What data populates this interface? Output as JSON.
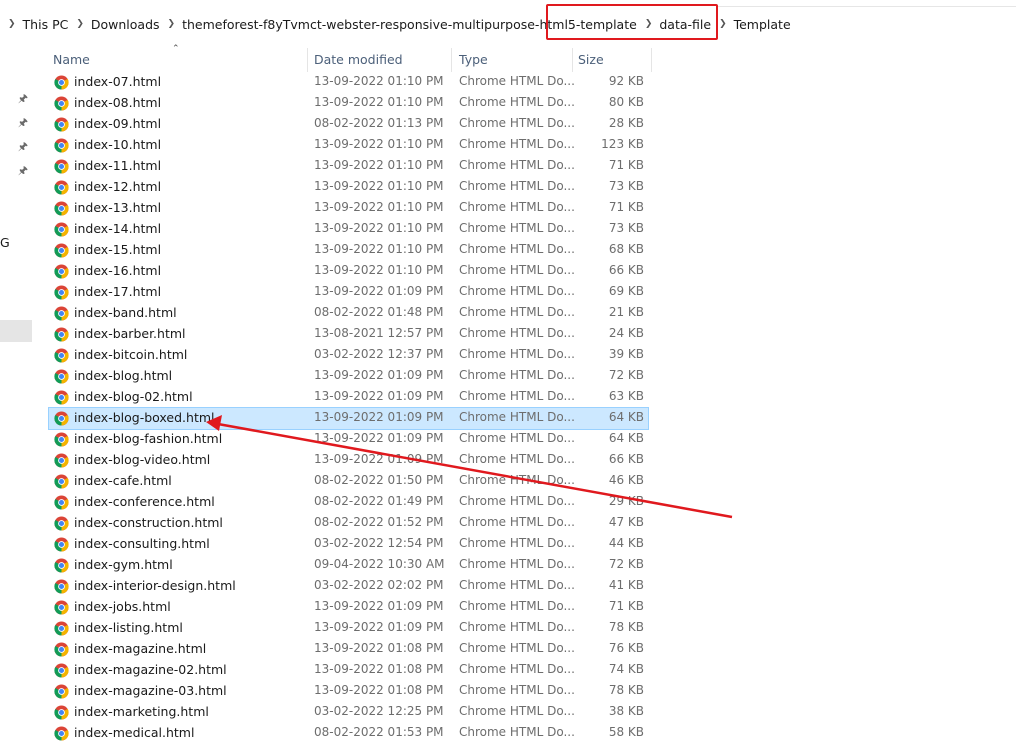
{
  "breadcrumb": {
    "items": [
      "This PC",
      "Downloads",
      "themeforest-f8yTvmct-webster-responsive-multipurpose-html5-template",
      "data-file",
      "Template"
    ]
  },
  "nav": {
    "partial_label": "G"
  },
  "columns": {
    "name": "Name",
    "date": "Date modified",
    "type": "Type",
    "size": "Size"
  },
  "files": [
    {
      "name": "index-07.html",
      "date": "13-09-2022 01:10 PM",
      "type": "Chrome HTML Do...",
      "size": "92 KB"
    },
    {
      "name": "index-08.html",
      "date": "13-09-2022 01:10 PM",
      "type": "Chrome HTML Do...",
      "size": "80 KB"
    },
    {
      "name": "index-09.html",
      "date": "08-02-2022 01:13 PM",
      "type": "Chrome HTML Do...",
      "size": "28 KB"
    },
    {
      "name": "index-10.html",
      "date": "13-09-2022 01:10 PM",
      "type": "Chrome HTML Do...",
      "size": "123 KB"
    },
    {
      "name": "index-11.html",
      "date": "13-09-2022 01:10 PM",
      "type": "Chrome HTML Do...",
      "size": "71 KB"
    },
    {
      "name": "index-12.html",
      "date": "13-09-2022 01:10 PM",
      "type": "Chrome HTML Do...",
      "size": "73 KB"
    },
    {
      "name": "index-13.html",
      "date": "13-09-2022 01:10 PM",
      "type": "Chrome HTML Do...",
      "size": "71 KB"
    },
    {
      "name": "index-14.html",
      "date": "13-09-2022 01:10 PM",
      "type": "Chrome HTML Do...",
      "size": "73 KB"
    },
    {
      "name": "index-15.html",
      "date": "13-09-2022 01:10 PM",
      "type": "Chrome HTML Do...",
      "size": "68 KB"
    },
    {
      "name": "index-16.html",
      "date": "13-09-2022 01:10 PM",
      "type": "Chrome HTML Do...",
      "size": "66 KB"
    },
    {
      "name": "index-17.html",
      "date": "13-09-2022 01:09 PM",
      "type": "Chrome HTML Do...",
      "size": "69 KB"
    },
    {
      "name": "index-band.html",
      "date": "08-02-2022 01:48 PM",
      "type": "Chrome HTML Do...",
      "size": "21 KB"
    },
    {
      "name": "index-barber.html",
      "date": "13-08-2021 12:57 PM",
      "type": "Chrome HTML Do...",
      "size": "24 KB"
    },
    {
      "name": "index-bitcoin.html",
      "date": "03-02-2022 12:37 PM",
      "type": "Chrome HTML Do...",
      "size": "39 KB"
    },
    {
      "name": "index-blog.html",
      "date": "13-09-2022 01:09 PM",
      "type": "Chrome HTML Do...",
      "size": "72 KB"
    },
    {
      "name": "index-blog-02.html",
      "date": "13-09-2022 01:09 PM",
      "type": "Chrome HTML Do...",
      "size": "63 KB"
    },
    {
      "name": "index-blog-boxed.html",
      "date": "13-09-2022 01:09 PM",
      "type": "Chrome HTML Do...",
      "size": "64 KB"
    },
    {
      "name": "index-blog-fashion.html",
      "date": "13-09-2022 01:09 PM",
      "type": "Chrome HTML Do...",
      "size": "64 KB"
    },
    {
      "name": "index-blog-video.html",
      "date": "13-09-2022 01:09 PM",
      "type": "Chrome HTML Do...",
      "size": "66 KB"
    },
    {
      "name": "index-cafe.html",
      "date": "08-02-2022 01:50 PM",
      "type": "Chrome HTML Do...",
      "size": "46 KB"
    },
    {
      "name": "index-conference.html",
      "date": "08-02-2022 01:49 PM",
      "type": "Chrome HTML Do...",
      "size": "29 KB"
    },
    {
      "name": "index-construction.html",
      "date": "08-02-2022 01:52 PM",
      "type": "Chrome HTML Do...",
      "size": "47 KB"
    },
    {
      "name": "index-consulting.html",
      "date": "03-02-2022 12:54 PM",
      "type": "Chrome HTML Do...",
      "size": "44 KB"
    },
    {
      "name": "index-gym.html",
      "date": "09-04-2022 10:30 AM",
      "type": "Chrome HTML Do...",
      "size": "72 KB"
    },
    {
      "name": "index-interior-design.html",
      "date": "03-02-2022 02:02 PM",
      "type": "Chrome HTML Do...",
      "size": "41 KB"
    },
    {
      "name": "index-jobs.html",
      "date": "13-09-2022 01:09 PM",
      "type": "Chrome HTML Do...",
      "size": "71 KB"
    },
    {
      "name": "index-listing.html",
      "date": "13-09-2022 01:09 PM",
      "type": "Chrome HTML Do...",
      "size": "78 KB"
    },
    {
      "name": "index-magazine.html",
      "date": "13-09-2022 01:08 PM",
      "type": "Chrome HTML Do...",
      "size": "76 KB"
    },
    {
      "name": "index-magazine-02.html",
      "date": "13-09-2022 01:08 PM",
      "type": "Chrome HTML Do...",
      "size": "74 KB"
    },
    {
      "name": "index-magazine-03.html",
      "date": "13-09-2022 01:08 PM",
      "type": "Chrome HTML Do...",
      "size": "78 KB"
    },
    {
      "name": "index-marketing.html",
      "date": "03-02-2022 12:25 PM",
      "type": "Chrome HTML Do...",
      "size": "38 KB"
    },
    {
      "name": "index-medical.html",
      "date": "08-02-2022 01:53 PM",
      "type": "Chrome HTML Do...",
      "size": "58 KB"
    }
  ],
  "selected_file": "index-blog-boxed.html",
  "icons": {
    "file": "chrome-icon",
    "pin": "pin-icon",
    "separator": "chevron-right-icon",
    "sort": "sort-up-icon"
  },
  "colors": {
    "annotation": "#e0191e",
    "selection": "#cce8ff",
    "header_text": "#4c607a"
  }
}
